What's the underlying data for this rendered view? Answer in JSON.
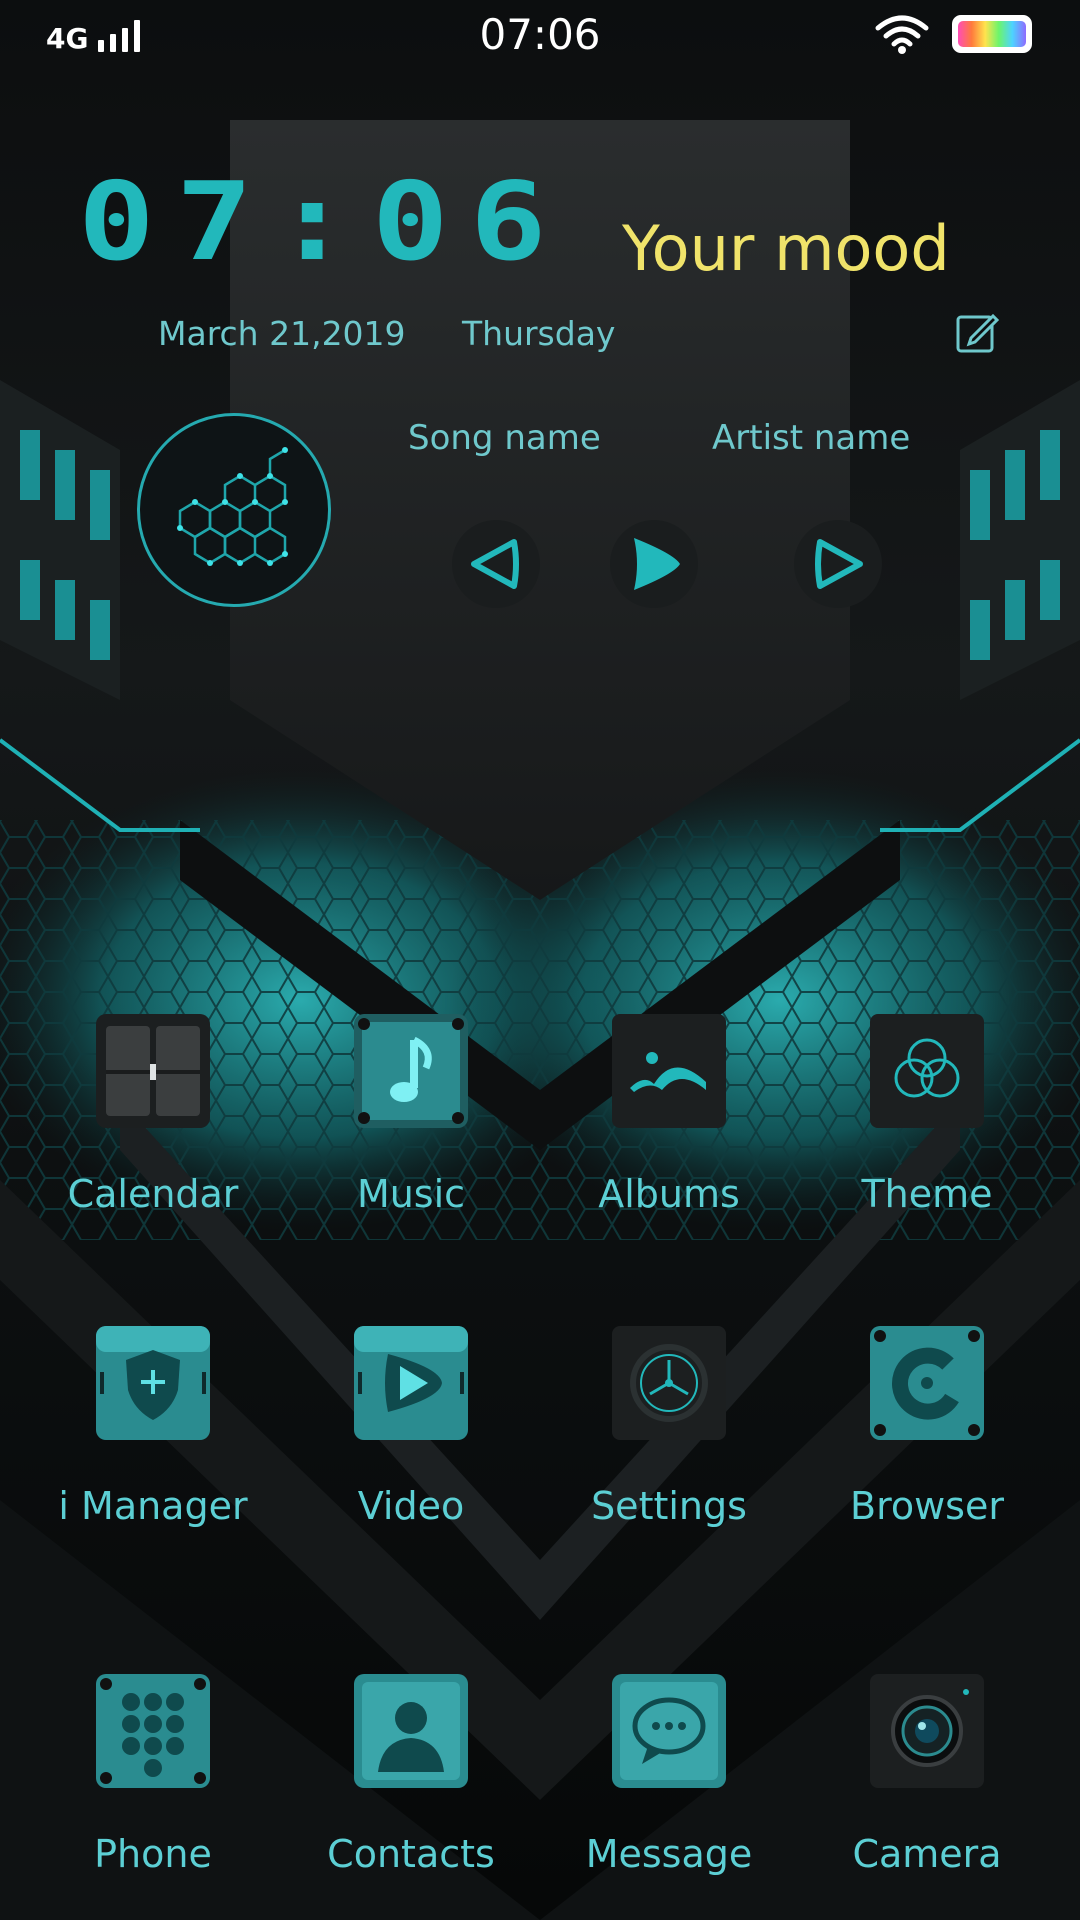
{
  "status_bar": {
    "network": "4G",
    "time": "07:06",
    "icons": [
      "signal-icon",
      "wifi-icon",
      "battery-icon"
    ]
  },
  "clock_widget": {
    "time": "07:06",
    "mood": "Your mood",
    "date": "March 21,2019",
    "weekday": "Thursday",
    "edit_icon": "edit-icon"
  },
  "music_widget": {
    "song": "Song name",
    "artist": "Artist name",
    "controls": [
      "previous-icon",
      "play-icon",
      "next-icon"
    ]
  },
  "apps": [
    {
      "label": "Calendar",
      "icon": "calendar-icon"
    },
    {
      "label": "Music",
      "icon": "music-note-icon"
    },
    {
      "label": "Albums",
      "icon": "albums-icon"
    },
    {
      "label": "Theme",
      "icon": "theme-icon"
    },
    {
      "label": "i Manager",
      "icon": "shield-icon"
    },
    {
      "label": "Video",
      "icon": "video-play-icon"
    },
    {
      "label": "Settings",
      "icon": "settings-icon"
    },
    {
      "label": "Browser",
      "icon": "browser-icon"
    },
    {
      "label": "Phone",
      "icon": "dialpad-icon"
    },
    {
      "label": "Contacts",
      "icon": "contact-icon"
    },
    {
      "label": "Message",
      "icon": "message-icon"
    },
    {
      "label": "Camera",
      "icon": "camera-icon"
    }
  ],
  "colors": {
    "accent": "#22b8bb",
    "label": "#5ccfd4",
    "mood": "#f0e36a",
    "background": "#0b0d0e"
  }
}
